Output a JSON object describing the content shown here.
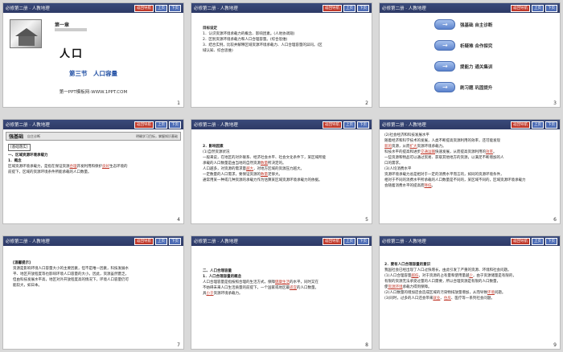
{
  "slides": [
    {
      "num": "1",
      "header": "必修第二册 · 人教地理",
      "nav": "返回导航",
      "prev": "上页",
      "next": "下页",
      "chapter": "第一章",
      "title": "人口",
      "section": "第三节　人口容量",
      "credit": "第一PPT模板网-WWW.1PPT.COM"
    },
    {
      "num": "2",
      "header": "必修第二册 · 人教地理",
      "nav": "返回导航",
      "prev": "上页",
      "next": "下页",
      "heading": "目标设定",
      "lines": [
        "1．认识资源环境承载力的概念、影响因素。(人地协调观)",
        "2．区别资源环境承载力和人口合理容量。(综合思维)",
        "3．结合实例，比较并解释区域资源环境承载力、人口合理容量的异同。(区",
        "域认知、综合思维)"
      ]
    },
    {
      "num": "3",
      "header": "必修第二册 · 人教地理",
      "nav": "返回导航",
      "prev": "上页",
      "next": "下页",
      "menu": [
        "强基础 自主诊断",
        "析疑难 合作探究",
        "提能力 通关集训",
        "刷习题 巩固提升"
      ]
    },
    {
      "num": "4",
      "header": "必修第二册 · 人教地理",
      "nav": "返回导航",
      "prev": "上页",
      "next": "下页",
      "strip_lead": "强基础",
      "strip_mid": "自主诊断",
      "strip_right": "明确学习目标，掌握知识基础",
      "tag": "[基础落实]",
      "h1": "一、区域资源环境承载力",
      "h2": "1．概念",
      "p1a": "区域资源环境承载力，是指在保证资源",
      "p1b": "合理",
      "p1c": "开发利用和保护",
      "p1d": "良好",
      "p1e": "生态环境的",
      "p2": "前提下，区域的资源环境条件所能承载的人口数量。"
    },
    {
      "num": "5",
      "header": "必修第二册 · 人教地理",
      "nav": "返回导航",
      "prev": "上页",
      "next": "下页",
      "h1": "2．影响因素",
      "h2": "(1)自然资源状况",
      "l1": "一般来说，在地区的对外联系、经济社会水平、社会文化条件下，某区域所能",
      "l2a": "承载的人口数量是由当地的自然资源",
      "l2b": "数量",
      "l2c": "所决定的。",
      "l3a": "人口越多，对资源的需求量",
      "l3b": "越大",
      "l3c": "，对地方区域的资源压力越大。",
      "l4a": "一定数量的人口需求，要保证资源的",
      "l4b": "数量",
      "l4c": "足够大。",
      "l5": "通常用某一种或几种资源的承载力作为估算某区域资源环境承载力的依据。"
    },
    {
      "num": "6",
      "header": "必修第二册 · 人教地理",
      "nav": "返回导航",
      "prev": "上页",
      "next": "下页",
      "l1": "(2)社会经济和科技发展水平",
      "l2": "随着经济和科学技术的发展，人类不断提高资源利用的效率，还可能发现",
      "l3a": "新的",
      "l3b": "资源",
      "l3c": "，从而",
      "l3d": "扩大",
      "l3e": "资源环境承载力。",
      "l4a": "科技水平的提高和进步",
      "l4b": "交通运输",
      "l4c": "快速发展，从而提高资源利用的",
      "l4d": "效率",
      "l4e": "。",
      "l5": "一些资源和物品可以通过贸易、获取其他地方的资源，以满足不断增加的人",
      "l6": "口的需求。",
      "l7": "(3)人均消费水平",
      "l8": "资源环境承载力总是相对于一定的消费水平而言的，如同的资源环境条件，",
      "l9": "相对于不同的消费水平所承载的人口数量是不同的，某区域不同的，区域资源环境承载力",
      "l10a": "会随着消费水平的提高而",
      "l10b": "降低",
      "l10c": "。"
    },
    {
      "num": "7",
      "header": "必修第二册 · 人教地理",
      "nav": "返回导航",
      "prev": "上页",
      "next": "下页",
      "tag": "[温馨提示]",
      "l1": "资源是影响环境人口容量大小的主要因素，但不是唯一因素，科技发展水",
      "l2": "平、地区开放程度等也影响环境人口容量的大小。因此，资源虽然匮乏，",
      "l3": "但由科技发展水平高，地区对外开放程度高的情况下，环境人口容量仍可",
      "l4": "能较大，如日本。"
    },
    {
      "num": "8",
      "header": "必修第二册 · 人教地理",
      "nav": "返回导航",
      "prev": "上页",
      "next": "下页",
      "h1": "二、人口合理容量",
      "h2": "1．人口合理容量的概念",
      "l1a": "人口合理容量是指按照合理的生活方式，保障",
      "l1b": "健康生活",
      "l1c": "的水平，同时又在",
      "l2a": "不妨碍未来人口生活质量的前提下，一个国家或地区最",
      "l2b": "适宜",
      "l2c": "的人口数量。",
      "l3a": "具",
      "l3b": "小于",
      "l3c": "资源环境承载力。"
    },
    {
      "num": "9",
      "header": "必修第二册 · 人教地理",
      "nav": "返回导航",
      "prev": "上页",
      "next": "下页",
      "h1": "2．要有人口合理容量的意识",
      "l1": "我国社会已经出现了人口过快增长，由此引发了严重的资源、环境和社会问题。",
      "l2a": "(1)人口合理容量",
      "l2b": "越低",
      "l2c": "，对于资源的占有量和使用量越",
      "l2d": "少",
      "l2e": "，由于资源储量是有限的，",
      "l3": "有限的资源无法承受过量的人口需要，所以合理资源是有限的人口数量，",
      "l4a": "使",
      "l4b": "资源环境",
      "l4c": "承载力得到保障。",
      "l5a": "(2)人口数量的增加还会造成区域的污染物排放量增加，从而导致",
      "l5b": "环境",
      "l5c": "问题。",
      "l6a": "(3)同时，过多的人口还会带来",
      "l6b": "就业",
      "l6c": "、",
      "l6d": "住房",
      "l6e": "、医疗等一系列社会问题。"
    }
  ],
  "colors": {
    "header_bg": "#2e3a66",
    "nav_button": "#c0392b",
    "page_button": "#4d6cb5",
    "accent_text": "#c0392b",
    "section_blue": "#1f4ea3"
  }
}
